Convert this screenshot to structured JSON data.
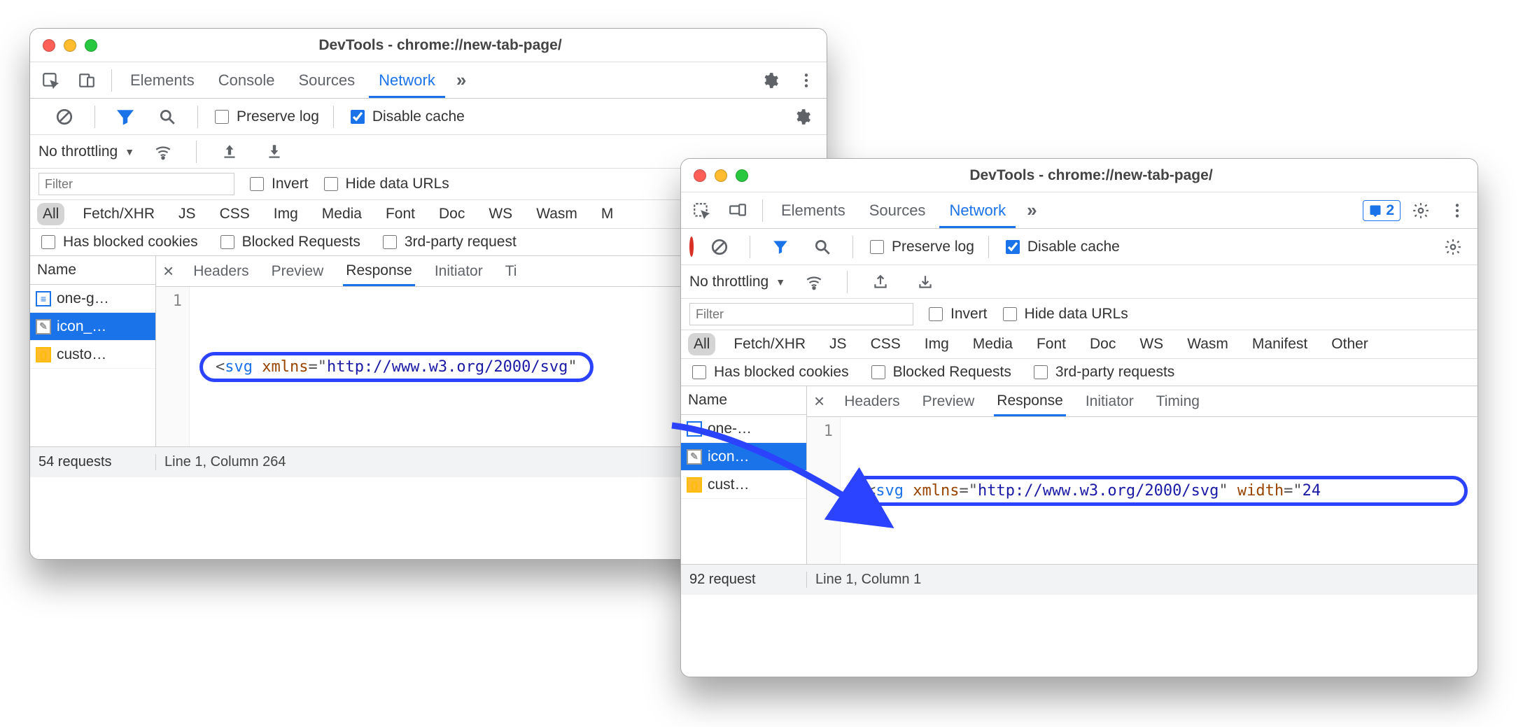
{
  "title_a": "DevTools - chrome://new-tab-page/",
  "title_b": "DevTools - chrome://new-tab-page/",
  "tabs": {
    "elements": "Elements",
    "console": "Console",
    "sources": "Sources",
    "network": "Network"
  },
  "netbar": {
    "preserve_log": "Preserve log",
    "disable_cache": "Disable cache"
  },
  "throttle": {
    "label": "No throttling"
  },
  "filter": {
    "placeholder": "Filter",
    "invert": "Invert",
    "hide_urls": "Hide data URLs"
  },
  "pills": [
    "All",
    "Fetch/XHR",
    "JS",
    "CSS",
    "Img",
    "Media",
    "Font",
    "Doc",
    "WS",
    "Wasm",
    "Manifest",
    "Other"
  ],
  "pills_a_last": "M",
  "extras": {
    "blocked_cookies": "Has blocked cookies",
    "blocked_requests": "Blocked Requests",
    "third_party_a": "3rd-party request",
    "third_party_b": "3rd-party requests"
  },
  "names_header": "Name",
  "files_a": [
    "one-g…",
    "icon_…",
    "custo…"
  ],
  "files_b": [
    "one-…",
    "icon…",
    "cust…"
  ],
  "detail_tabs": [
    "Headers",
    "Preview",
    "Response",
    "Initiator",
    "Timing"
  ],
  "detail_tabs_a_last": "Ti",
  "line_no": "1",
  "code_a": {
    "tag_open": "<",
    "tag": "svg",
    "sp": " ",
    "attr1": "xmlns",
    "eq": "=",
    "q": "\"",
    "val1": "http://www.w3.org/2000/svg"
  },
  "code_b": {
    "tag_open": "<",
    "tag": "svg",
    "attr1": "xmlns",
    "val1": "http://www.w3.org/2000/svg",
    "attr2": "width",
    "val2": "24"
  },
  "status_a": {
    "requests": "54 requests",
    "pos": "Line 1, Column 264"
  },
  "status_b": {
    "requests": "92 request",
    "pos": "Line 1, Column 1"
  },
  "badge_count": "2"
}
